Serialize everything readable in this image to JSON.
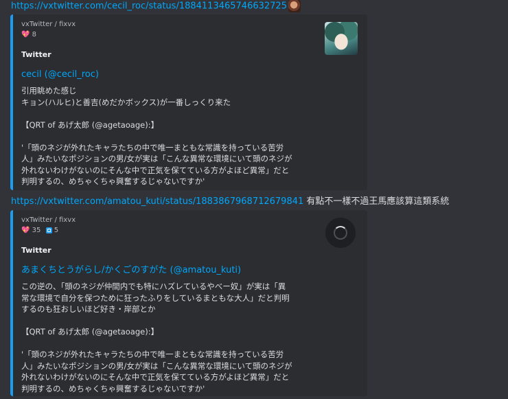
{
  "messages": [
    {
      "link": "https://vxtwitter.com/cecil_roc/status/1884113465746632725",
      "trailing_text": "",
      "embed": {
        "provider": "vxTwitter / fixvx",
        "likes": "8",
        "retweets": "",
        "source": "Twitter",
        "author": "cecil (@cecil_roc)",
        "description": "引用眺めた感じ\nキョン(ハルヒ)と善吉(めだかボックス)が一番しっくり来た\n\n【QRT of あげ太郎 (@agetaoage):】\n\n'「頭のネジが外れたキャラたちの中で唯一まともな常識を持っている苦労\n人」みたいなポジションの男/女が実は「こんな異常な環境にいて頭のネジが\n外れないわけがないのにそんな中で正気を保てている方がよほど異常」だと\n判明するの、めちゃくちゃ興奮するじゃないですか'"
      }
    },
    {
      "link": "https://vxtwitter.com/amatou_kuti/status/1883867968712679841",
      "trailing_text": "有點不一樣不過王馬應該算這類系統",
      "embed": {
        "provider": "vxTwitter / fixvx",
        "likes": "35",
        "retweets": "5",
        "source": "Twitter",
        "author": "あまくちとうがらし/かくごのすがた (@amatou_kuti)",
        "description": "この逆の、「頭のネジが仲間内でも特にハズレているやべー奴」が実は「異\n常な環境で自分を保つために狂ったふりをしているまともな大人」だと判明\nするのも狂おしいほど好き・岸部とか\n\n【QRT of あげ太郎 (@agetaoage):】\n\n'「頭のネジが外れたキャラたちの中で唯一まともな常識を持っている苦労\n人」みたいなポジションの男/女が実は「こんな異常な環境にいて頭のネジが\n外れないわけがないのにそんな中で正気を保てている方がよほど異常」だと\n判明するの、めちゃくちゃ興奮するじゃないですか'"
      }
    }
  ],
  "colors": {
    "link": "#00a8fc",
    "embed_border": "#1d9bf0",
    "background": "#313338",
    "embed_bg": "#2b2d31"
  }
}
